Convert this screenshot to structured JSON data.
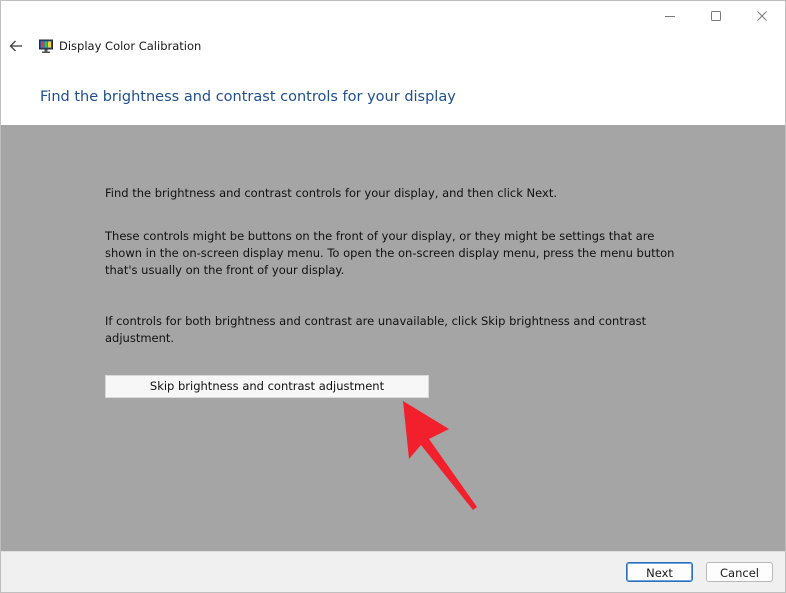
{
  "window": {
    "title": "Display Color Calibration"
  },
  "titlebar": {
    "buttons": [
      "minimize-icon",
      "maximize-icon",
      "close-icon"
    ]
  },
  "header": {
    "back_icon": "back-arrow-icon",
    "app_icon": "display-monitor-icon",
    "heading": "Find the brightness and contrast controls for your display"
  },
  "content": {
    "paragraph1": "Find the brightness and contrast controls for your display, and then click Next.",
    "paragraph2": "These controls might be buttons on the front of your display, or they might be settings that are shown in the on-screen display menu. To open the on-screen display menu, press the menu button that's usually on the front of your display.",
    "paragraph3": "If controls for both brightness and contrast are unavailable, click Skip brightness and contrast adjustment.",
    "skip_button_label": "Skip brightness and contrast adjustment",
    "annotation_icon": "red-pointer-arrow-icon"
  },
  "footer": {
    "next_label": "Next",
    "cancel_label": "Cancel"
  },
  "colors": {
    "heading": "#1f4f8f",
    "content_background": "#a5a5a5",
    "annotation_arrow": "#f2202c",
    "default_button_border": "#2f6fb7"
  }
}
